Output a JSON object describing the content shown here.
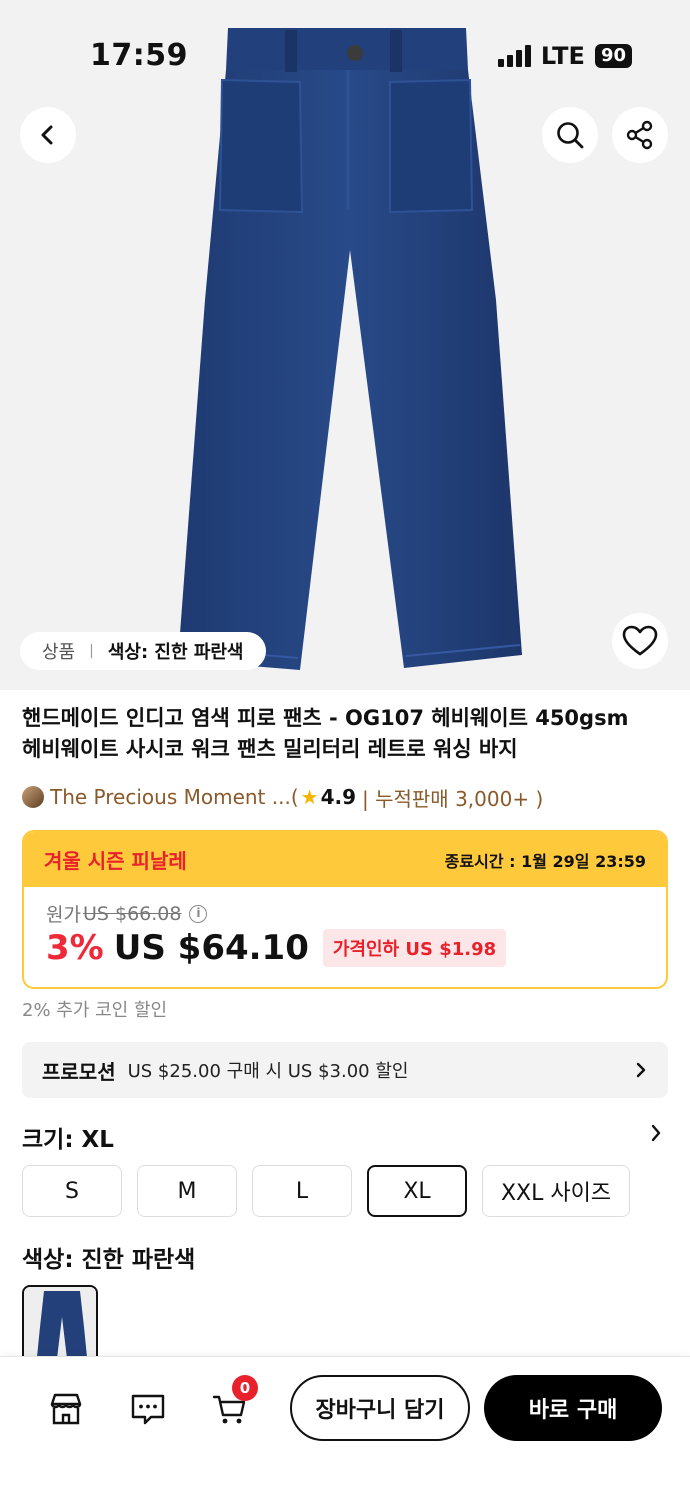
{
  "status": {
    "time": "17:59",
    "network": "LTE",
    "battery": "90"
  },
  "breadcrumb": {
    "category": "상품",
    "color": "색상: 진한 파란색"
  },
  "product": {
    "title_line1": "핸드메이드 인디고 염색 피로 팬츠 - OG107 헤비웨이트 450gsm",
    "title_line2": "헤비웨이트 사시코 워크 팬츠 밀리터리 레트로 워싱 바지"
  },
  "store": {
    "name": "The Precious Moment ...",
    "open_paren": " (",
    "rating": "4.9",
    "sales": "| 누적판매 3,000+ )"
  },
  "sale": {
    "name": "겨울 시즌 피날레",
    "end_time": "종료시간 : 1월 29일 23:59",
    "original_label": "원가",
    "original_price": "US $66.08",
    "discount": "3%",
    "price": "US $64.10",
    "drop_badge": "가격인하 US $1.98"
  },
  "coin_discount": "2% 추가 코인 할인",
  "promotion": {
    "title": "프로모션",
    "desc": "US $25.00 구매 시 US $3.00 할인"
  },
  "size": {
    "label": "크기: XL",
    "options": [
      "S",
      "M",
      "L",
      "XL",
      "XXL 사이즈"
    ],
    "selected": "XL"
  },
  "color": {
    "label": "색상: 진한 파란색"
  },
  "bottom": {
    "cart_count": "0",
    "add_to_cart": "장바구니 담기",
    "buy_now": "바로 구매"
  },
  "icons": {
    "back": "chevron-left-icon",
    "search": "search-icon",
    "share": "share-icon",
    "favorite": "heart-icon",
    "store": "store-icon",
    "chat": "chat-icon",
    "cart": "cart-icon"
  },
  "colors": {
    "accent_red": "#e8212b",
    "sale_yellow": "#ffc93c",
    "denim": "#23407a"
  }
}
